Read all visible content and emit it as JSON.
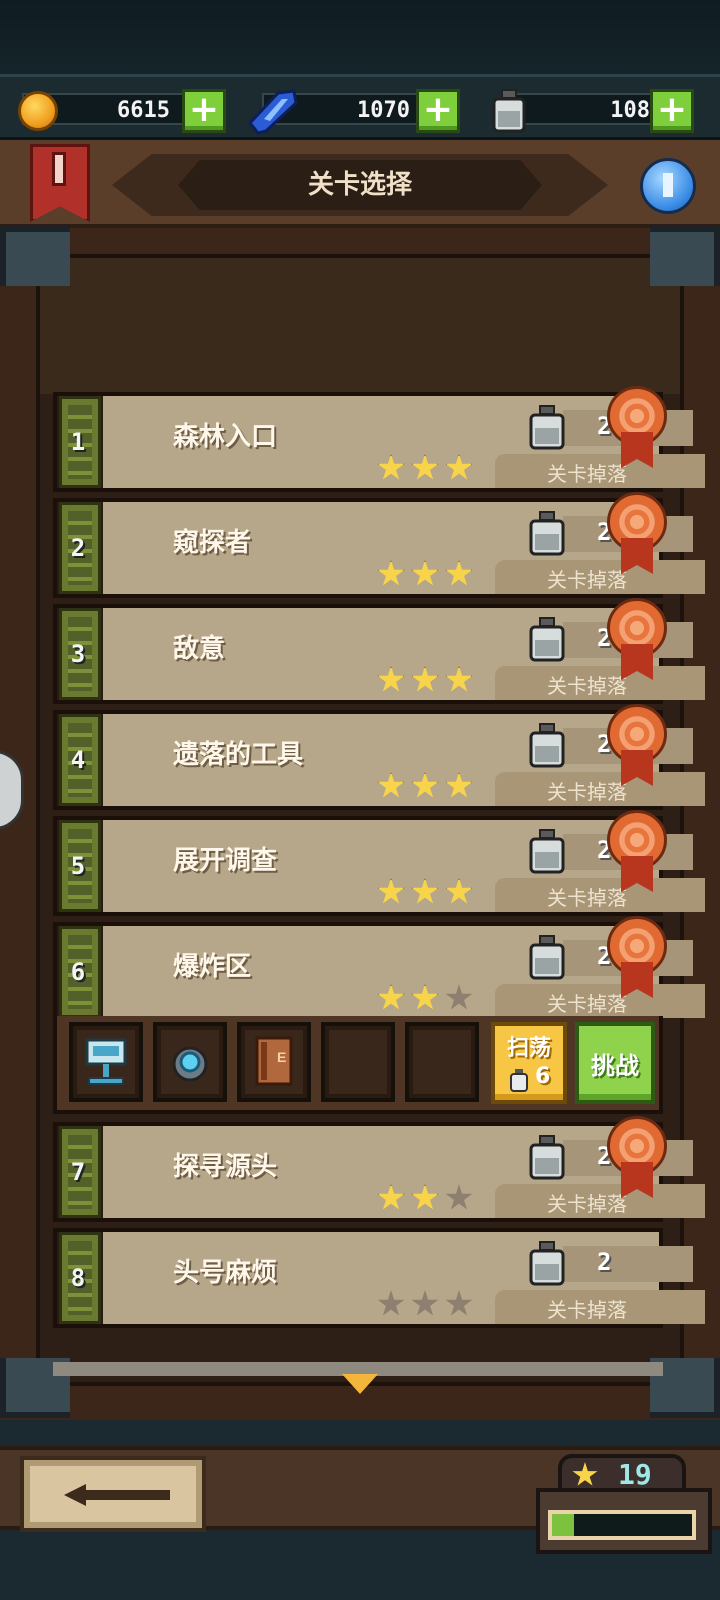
{
  "resources": {
    "coins": "6615",
    "gems": "1070",
    "jars": "108"
  },
  "title": "关卡选择",
  "bookmark_label": "I",
  "drop_label": "关卡掉落",
  "levels": [
    {
      "number": "1",
      "name": "森林入口",
      "stars": 3,
      "drop": "2",
      "medal": true
    },
    {
      "number": "2",
      "name": "窥探者",
      "stars": 3,
      "drop": "2",
      "medal": true
    },
    {
      "number": "3",
      "name": "敌意",
      "stars": 3,
      "drop": "2",
      "medal": true
    },
    {
      "number": "4",
      "name": "遗落的工具",
      "stars": 3,
      "drop": "2",
      "medal": true
    },
    {
      "number": "5",
      "name": "展开调查",
      "stars": 3,
      "drop": "2",
      "medal": true
    },
    {
      "number": "6",
      "name": "爆炸区",
      "stars": 2,
      "drop": "2",
      "medal": true
    },
    {
      "number": "7",
      "name": "探寻源头",
      "stars": 2,
      "drop": "2",
      "medal": true
    },
    {
      "number": "8",
      "name": "头号麻烦",
      "stars": 0,
      "drop": "2",
      "medal": false
    }
  ],
  "expanded": {
    "items": [
      "armor-stand-icon",
      "blue-gem-ring-icon",
      "book-e-icon",
      "empty-slot",
      "empty-slot"
    ],
    "sweep_label": "扫荡",
    "sweep_cost": "6",
    "challenge_label": "挑战"
  },
  "star_total": "19",
  "star_progress": 0.16,
  "colors": {
    "accent_green": "#7fcf3c",
    "sweep_yellow": "#f6c644",
    "star_gold": "#f8d44a"
  }
}
